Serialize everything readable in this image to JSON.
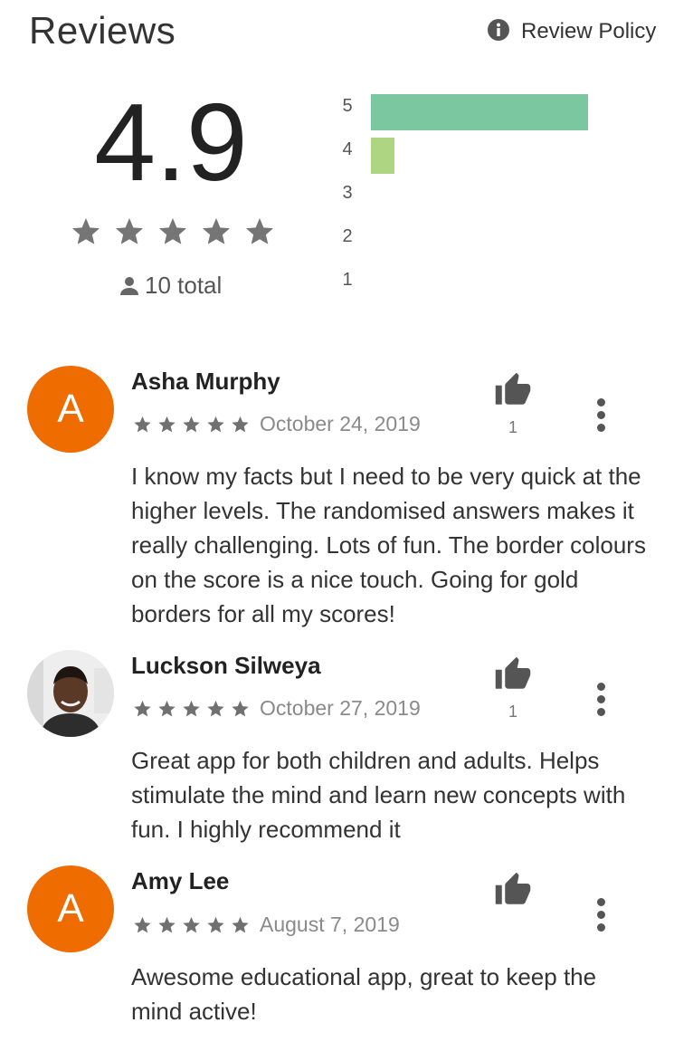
{
  "header": {
    "title": "Reviews",
    "policy_label": "Review Policy"
  },
  "summary": {
    "rating": "4.9",
    "stars": 5,
    "total_label": "10 total",
    "histogram": [
      {
        "label": "5",
        "fraction": 1.0,
        "color": "#7bc8a0"
      },
      {
        "label": "4",
        "fraction": 0.11,
        "color": "#aed581"
      },
      {
        "label": "3",
        "fraction": 0,
        "color": "#ffd54f"
      },
      {
        "label": "2",
        "fraction": 0,
        "color": "#ffb74d"
      },
      {
        "label": "1",
        "fraction": 0,
        "color": "#ff8a65"
      }
    ]
  },
  "reviews": [
    {
      "initial": "A",
      "name": "Asha Murphy",
      "stars": 5,
      "date": "October 24, 2019",
      "helpful_count": "1",
      "text": "I know my facts but I need to be very quick at the higher levels. The randomised answers makes it really challenging. Lots of fun. The border colours on the score is a nice touch. Going for gold borders for all my scores!"
    },
    {
      "initial": "",
      "name": "Luckson Silweya",
      "stars": 5,
      "date": "October 27, 2019",
      "helpful_count": "1",
      "text": "Great app for both children and adults. Helps stimulate the mind and learn new concepts with fun. I highly recommend it"
    },
    {
      "initial": "A",
      "name": "Amy Lee",
      "stars": 5,
      "date": "August 7, 2019",
      "helpful_count": "",
      "text": "Awesome educational app, great to keep the mind active!"
    }
  ],
  "colors": {
    "avatar": "#ef6c00",
    "star": "#777777"
  }
}
